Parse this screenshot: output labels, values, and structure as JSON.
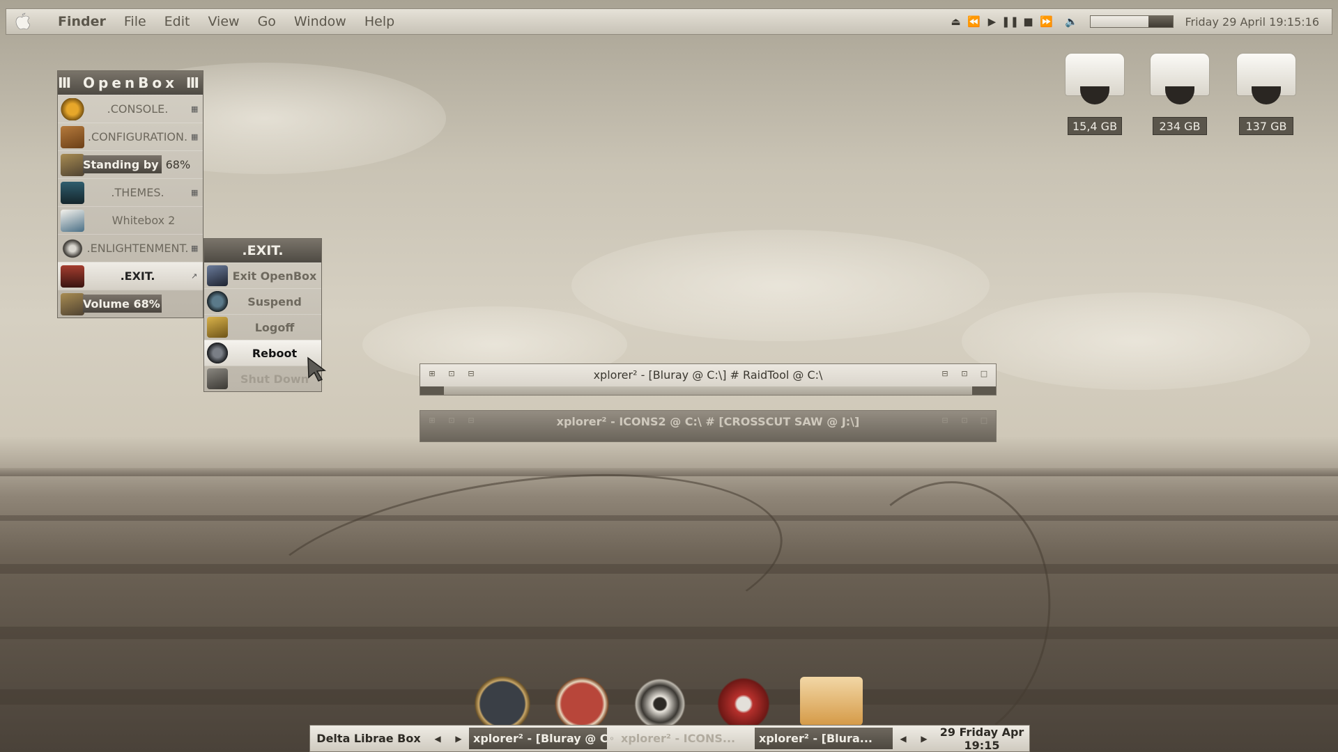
{
  "menubar": {
    "app": "Finder",
    "items": [
      "File",
      "Edit",
      "View",
      "Go",
      "Window",
      "Help"
    ],
    "clock": "Friday 29 April 19:15:16",
    "volume_fraction": 0.3
  },
  "drives": [
    {
      "label": "15,4 GB"
    },
    {
      "label": "234 GB"
    },
    {
      "label": "137 GB"
    }
  ],
  "openbox_menu": {
    "title": "Ⅲ OpenBox Ⅲ",
    "items": [
      {
        "label": ".CONSOLE."
      },
      {
        "label": ".CONFIGURATION."
      },
      {
        "label": "Standing by",
        "percent": "68%",
        "fraction": 0.68
      },
      {
        "label": ".THEMES."
      },
      {
        "label": "Whitebox 2"
      },
      {
        "label": ".ENLIGHTENMENT."
      },
      {
        "label": ".EXIT."
      },
      {
        "label": "Volume  68%",
        "fraction": 0.68
      }
    ]
  },
  "exit_menu": {
    "title": ".EXIT.",
    "items": [
      {
        "label": "Exit OpenBox"
      },
      {
        "label": "Suspend"
      },
      {
        "label": "Logoff"
      },
      {
        "label": "Reboot"
      },
      {
        "label": "Shut Down"
      }
    ]
  },
  "windows": [
    {
      "title": "xplorer² - [Bluray @ C:\\] # RaidTool @ C:\\"
    },
    {
      "title": "xplorer² - ICONS2 @ C:\\ # [CROSSCUT SAW @ J:\\]"
    }
  ],
  "taskbar": {
    "start": "Delta Librae Box",
    "tasks": [
      {
        "label": "xplorer² - [Bluray @ C..."
      },
      {
        "label": "xplorer² - ICONS..."
      },
      {
        "label": "xplorer² - [Blura..."
      }
    ],
    "clock": "29 Friday Apr 19:15"
  },
  "colors": {
    "menu_title_bg": "#5e5950",
    "highlight": "#f5f3ee",
    "taskbar_active": "#5a554b"
  }
}
